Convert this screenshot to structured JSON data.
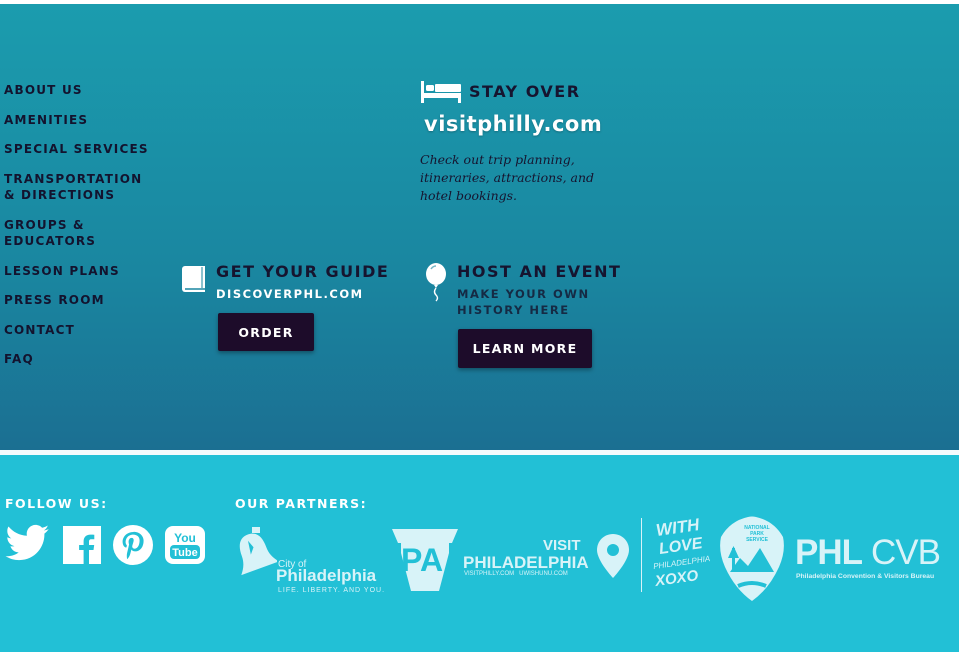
{
  "nav": {
    "items": [
      "ABOUT US",
      "AMENITIES",
      "SPECIAL SERVICES",
      "TRANSPORTATION & DIRECTIONS",
      "GROUPS & EDUCATORS",
      "LESSON PLANS",
      "PRESS ROOM",
      "CONTACT",
      "FAQ"
    ]
  },
  "stay": {
    "heading": "STAY OVER",
    "logo": "visitphilly.com",
    "description": "Check out trip planning, itineraries, attractions, and hotel bookings."
  },
  "guide": {
    "heading": "GET YOUR GUIDE",
    "sub": "DISCOVERPHL.COM",
    "button": "ORDER"
  },
  "event": {
    "heading": "HOST AN EVENT",
    "sub": "MAKE YOUR OWN HISTORY HERE",
    "button": "LEARN MORE"
  },
  "footer": {
    "follow_label": "FOLLOW US:",
    "partners_label": "OUR PARTNERS:",
    "social": [
      "twitter-icon",
      "facebook-icon",
      "pinterest-icon",
      "youtube-icon"
    ],
    "partners": {
      "city_small": "City of",
      "city": "Philadelphia",
      "city_tag": "LIFE. LIBERTY. AND YOU.",
      "pa": "PA",
      "visit_small": "VISIT",
      "visit": "PHILADELPHIA",
      "visit_tag": "VISITPHILLY.COM   UWISHUNU.COM",
      "love_1": "WITH",
      "love_2": "LOVE",
      "love_3": "PHILADELPHIA",
      "love_4": "XOXO",
      "nps": "NATIONAL PARK SERVICE",
      "phl": "PHL",
      "cvb": "CVB",
      "cvb_tag": "Philadelphia Convention & Visitors Bureau"
    }
  },
  "colors": {
    "top_start": "#1b9cae",
    "top_end": "#1b6f92",
    "bottom": "#22c0d6",
    "text_dark": "#16142f",
    "button": "#1d0c2a"
  }
}
